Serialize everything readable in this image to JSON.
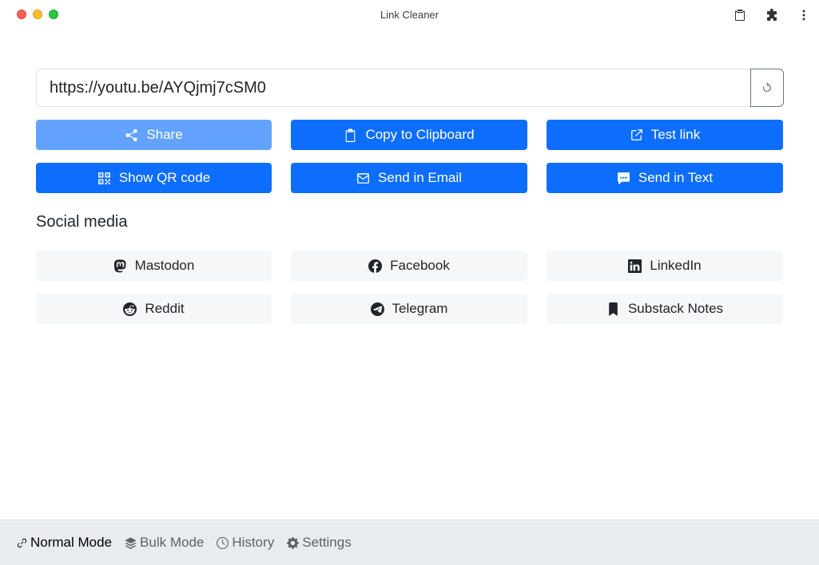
{
  "window": {
    "title": "Link Cleaner"
  },
  "url_field": {
    "value": "https://youtu.be/AYQjmj7cSM0"
  },
  "actions": {
    "share": "Share",
    "copy": "Copy to Clipboard",
    "test": "Test link",
    "qr": "Show QR code",
    "email": "Send in Email",
    "text": "Send in Text"
  },
  "social": {
    "heading": "Social media",
    "mastodon": "Mastodon",
    "facebook": "Facebook",
    "linkedin": "LinkedIn",
    "reddit": "Reddit",
    "telegram": "Telegram",
    "substack": "Substack Notes"
  },
  "footer": {
    "normal": "Normal Mode",
    "bulk": "Bulk Mode",
    "history": "History",
    "settings": "Settings"
  },
  "colors": {
    "primary": "#0d6efd",
    "primary_disabled": "#62a2fd",
    "light_button": "#f6f7f8",
    "footer_bg": "#e9ecef"
  }
}
